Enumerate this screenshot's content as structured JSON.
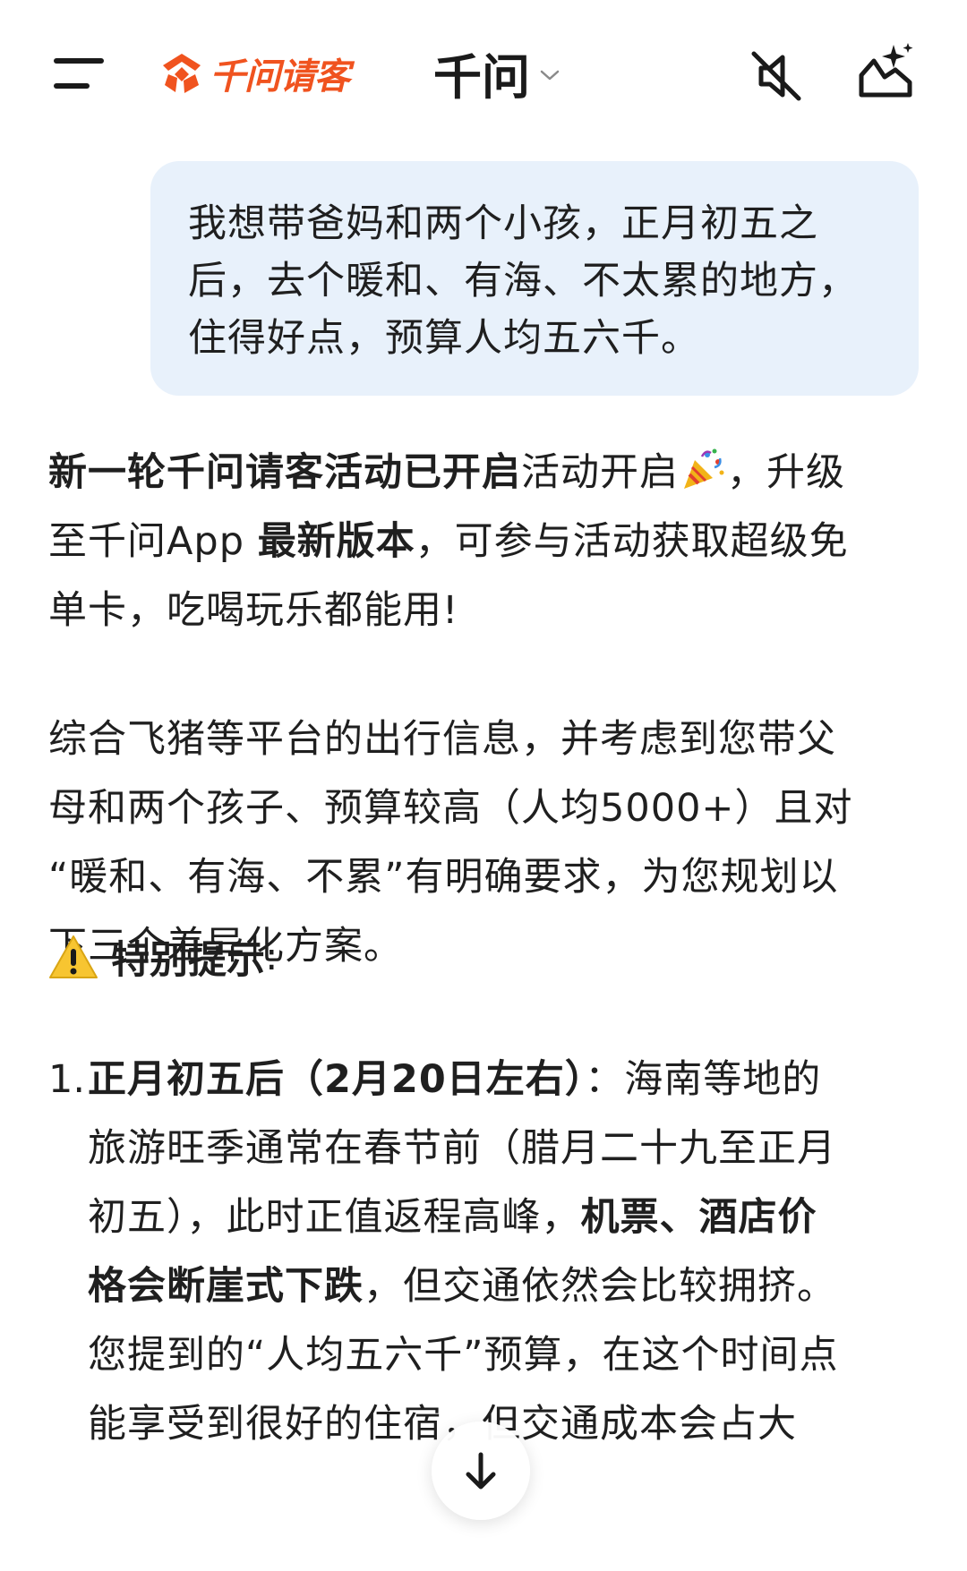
{
  "header": {
    "brand_text": "千问请客",
    "model_name": "千问",
    "icons": {
      "menu": "menu-icon",
      "logo": "qianwen-logo-icon",
      "chevron": "chevron-down-icon",
      "mute": "speaker-muted-icon",
      "new_chat": "new-chat-sparkle-icon"
    }
  },
  "user_message": {
    "lines": [
      "我想带爸妈和两个小孩，正月初五之",
      "后，去个暖和、有海、不太累的地方，",
      "住得好点，预算人均五六千。"
    ]
  },
  "answer": {
    "promo": {
      "l1_bold": "新一轮千问请客活动已开启",
      "l1_rest": "活动开启",
      "l1_tail": "，升级",
      "l2_a": "至千问App ",
      "l2_bold": "最新版本",
      "l2_b": "，可参与活动获取超级免",
      "l3": "单卡，吃喝玩乐都能用!"
    },
    "intro": {
      "lines": [
        "综合飞猪等平台的出行信息，并考虑到您带父",
        "母和两个孩子、预算较高（人均5000+）且对",
        "“暖和、有海、不累”有明确要求，为您规划以",
        "下三个差异化方案。"
      ]
    },
    "tip": {
      "title": "特别提示",
      "colon": ":"
    },
    "list_item_1": {
      "number": "1.",
      "l1_bold": "正月初五后（2月20日左右）",
      "l1_rest": "：海南等地的",
      "l2": "旅游旺季通常在春节前（腊月二十九至正月",
      "l3_a": "初五），此时正值返程高峰，",
      "l3_bold": "机票、酒店价",
      "l4_bold": "格会断崖式下跌",
      "l4_rest": "，但交通依然会比较拥挤。",
      "l5": "您提到的“人均五六千”预算，在这个时间点",
      "l6": "能享受到很好的住宿，但交通成本会占大"
    }
  },
  "colors": {
    "brand": "#f0531f",
    "bubble_bg": "#e8f1fb",
    "text": "#1f1f1f"
  }
}
